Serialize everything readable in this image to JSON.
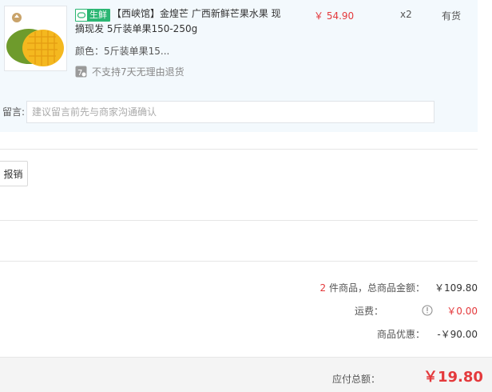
{
  "item": {
    "badge_label": "生鲜",
    "title": "【西峡馆】金煌芒 广西新鲜芒果水果 现摘现发 5斤装单果150-250g",
    "variant": "颜色：5斤装单果15...",
    "return_policy": "不支持7天无理由退货",
    "return_icon_text": "7",
    "price": "￥ 54.90",
    "quantity": "x2",
    "stock": "有货"
  },
  "remark": {
    "label": "留言:",
    "placeholder": "建议留言前先与商家沟通确认"
  },
  "reimburse_button": "报销",
  "summary": {
    "goods_count": "2",
    "goods_label": " 件商品，总商品金额：",
    "goods_total": "￥109.80",
    "shipping_label": "运费：",
    "shipping_value": "￥0.00",
    "discount_label": "商品优惠：",
    "discount_value": "-￥90.00",
    "payable_label": "应付总额：",
    "payable_value": "￥19.80"
  },
  "colors": {
    "accent_red": "#e4393c",
    "fresh_green": "#2bb673",
    "panel_bg": "#f3f9fd"
  }
}
